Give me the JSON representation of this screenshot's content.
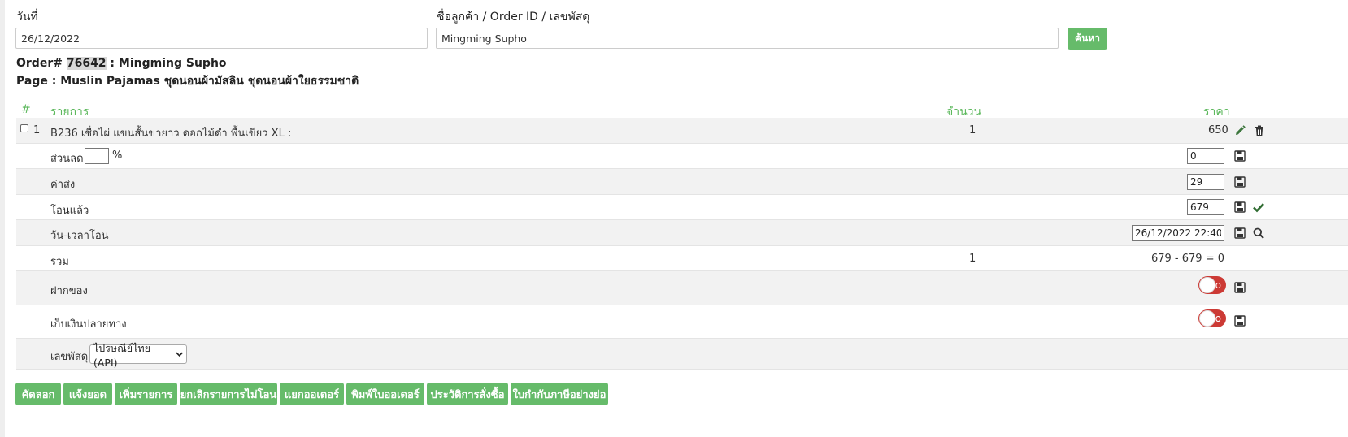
{
  "search": {
    "date_label": "วันที่",
    "date_value": "26/12/2022",
    "customer_label": "ชื่อลูกค้า / Order ID / เลขพัสดุ",
    "customer_value": "Mingming Supho",
    "search_button": "ค้นหา"
  },
  "order": {
    "prefix": "Order# ",
    "id": "76642",
    "name_sep": " : Mingming Supho",
    "page_line": "Page : Muslin Pajamas ชุดนอนผ้ามัสลิน ชุดนอนผ้าใยธรรมชาติ"
  },
  "table": {
    "col_num": "#",
    "col_item": "รายการ",
    "col_qty": "จำนวน",
    "col_price": "ราคา"
  },
  "item": {
    "num": "1",
    "name": "B236 เชื่อไผ่ แขนสั้นขายาว ดอกไม้ดำ พื้นเขียว XL :",
    "qty": "1",
    "price": "650"
  },
  "discount": {
    "label": "ส่วนลด",
    "percent_value": "",
    "percent_sign": "%",
    "value": "0"
  },
  "shipping": {
    "label": "ค่าส่ง",
    "value": "29"
  },
  "paid": {
    "label": "โอนแล้ว",
    "value": "679"
  },
  "paid_time": {
    "label": "วัน-เวลาโอน",
    "value": "26/12/2022 22:40"
  },
  "total": {
    "label": "รวม",
    "qty": "1",
    "calc": "679 - 679 = 0"
  },
  "deposit": {
    "label": "ฝากของ",
    "toggle": "No"
  },
  "cod": {
    "label": "เก็บเงินปลายทาง",
    "toggle": "No"
  },
  "tracking": {
    "label": "เลขพัสดุ",
    "selected": "ไปรษณีย์ไทย (API)"
  },
  "actions": {
    "copy": "คัดลอก",
    "notify": "แจ้งยอด",
    "add_item": "เพิ่มรายการ",
    "cancel_unpaid": "ยกเลิกรายการไม่โอน",
    "split": "แยกออเดอร์",
    "print": "พิมพ์ใบออเดอร์",
    "history": "ประวัติการสั่งซื้อ",
    "tax_invoice": "ใบกำกับภาษีอย่างย่อ"
  },
  "colors": {
    "accent": "#66bb6a",
    "header_text": "#5cb85c",
    "toggle_off": "#cc3a35",
    "row_alt": "#f2f2f2"
  }
}
